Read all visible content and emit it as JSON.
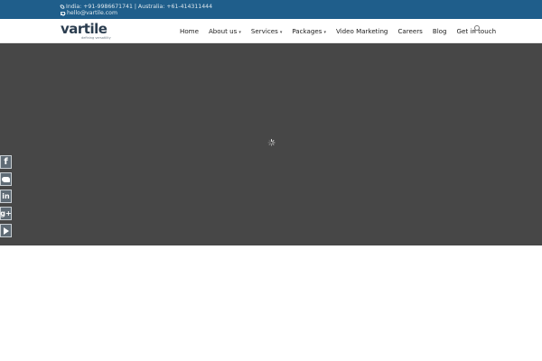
{
  "topbar": {
    "phone_text": "India: +91-9986671741 | Australia: +61-414311444",
    "email_text": "hello@vartile.com",
    "icons": [
      "phone-icon",
      "mail-icon"
    ],
    "background_color": "#1f5e8b"
  },
  "logo": {
    "wordmark": "vartile",
    "tagline": "defining versatility"
  },
  "nav": {
    "items": [
      {
        "label": "Home",
        "has_dropdown": false
      },
      {
        "label": "About us",
        "has_dropdown": true
      },
      {
        "label": "Services",
        "has_dropdown": true
      },
      {
        "label": "Packages",
        "has_dropdown": true
      },
      {
        "label": "Video Marketing",
        "has_dropdown": false
      },
      {
        "label": "Careers",
        "has_dropdown": false
      },
      {
        "label": "Blog",
        "has_dropdown": false
      },
      {
        "label": "Get in touch",
        "has_dropdown": false
      }
    ],
    "caret": "▾",
    "search_icon": "search-icon"
  },
  "hero": {
    "background_color": "#474747",
    "state": "loading"
  },
  "social": {
    "items": [
      {
        "name": "facebook",
        "glyph": "f"
      },
      {
        "name": "twitter",
        "glyph": ""
      },
      {
        "name": "linkedin",
        "glyph": "in"
      },
      {
        "name": "google-plus",
        "glyph": "g+"
      },
      {
        "name": "youtube",
        "glyph": ""
      }
    ]
  }
}
